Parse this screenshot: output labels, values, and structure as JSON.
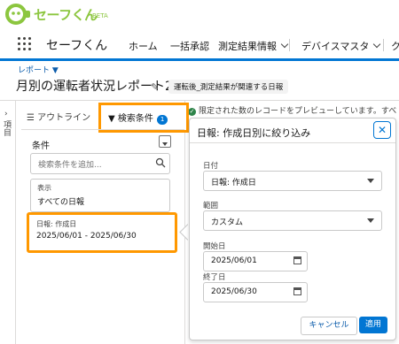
{
  "brand": {
    "logo_text": "セーフくん",
    "logo_sub": "BETA",
    "colors": {
      "brand_green": "#8cc63f",
      "accent_blue": "#0176d3",
      "highlight_orange": "#ff9800"
    }
  },
  "nav": {
    "app_name": "セーフくん",
    "items": [
      {
        "label": "ホーム",
        "icon": ""
      },
      {
        "label": "一括承認",
        "icon": ""
      },
      {
        "label": "測定結果情報",
        "icon": "chevron-down-icon"
      },
      {
        "label": "デバイスマスタ",
        "icon": "chevron-down-icon"
      },
      {
        "label": "ク",
        "icon": ""
      }
    ]
  },
  "header": {
    "breadcrumb": "レポート ▼",
    "title": "月別の運転者状況レポート2",
    "report_type": "運転後_測定結果が関連する日報"
  },
  "rail": {
    "label": "項目",
    "chevron": "›"
  },
  "preview_notice": "限定された数のレコードをプレビューしています。すべ",
  "panel": {
    "tab_outline": "☰ アウトライン",
    "tab_filters": "検索条件",
    "filter_count": "1",
    "conditions_label": "条件",
    "search_placeholder": "検索条件を追加...",
    "card1": {
      "label": "表示",
      "value": "すべての日報"
    },
    "card2": {
      "label": "日報: 作成日",
      "value": "2025/06/01 - 2025/06/30"
    }
  },
  "popover": {
    "title": "日報: 作成日別に絞り込み",
    "close": "✕",
    "field_label": "日付",
    "field_value": "日報: 作成日",
    "range_label": "範囲",
    "range_value": "カスタム",
    "start_label": "開始日",
    "start_value": "2025/06/01",
    "end_label": "終了日",
    "end_value": "2025/06/30",
    "cancel": "キャンセル",
    "apply": "適用"
  }
}
